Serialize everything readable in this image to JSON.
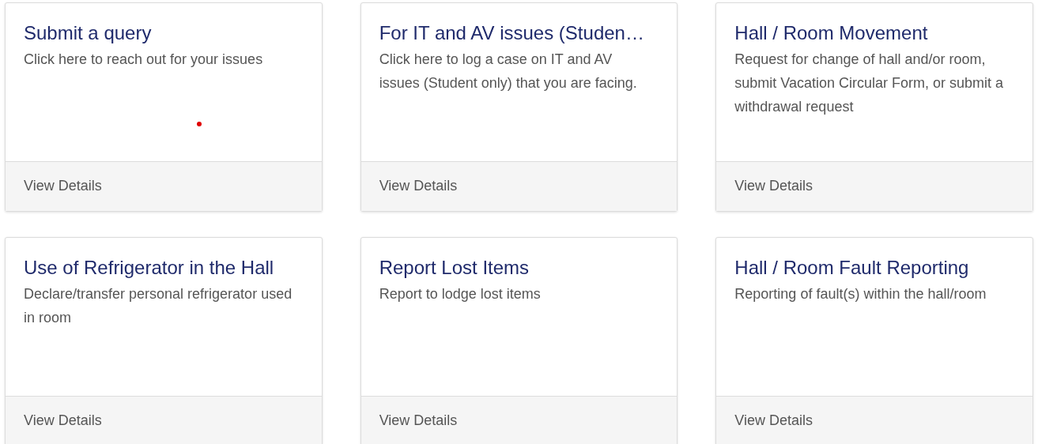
{
  "cards": [
    {
      "title": "Submit a query",
      "description": "Click here to reach out for your issues",
      "link": "View Details"
    },
    {
      "title": "For IT and AV issues (Studen…",
      "description": "Click here to log a case on IT and AV issues (Student only) that you are facing.",
      "link": "View Details"
    },
    {
      "title": "Hall / Room Movement",
      "description": "Request for change of hall and/or room, submit Vacation Circular Form, or submit a withdrawal request",
      "link": "View Details"
    },
    {
      "title": "Use of Refrigerator in the Hall",
      "description": "Declare/transfer personal refrigerator used in room",
      "link": "View Details"
    },
    {
      "title": "Report Lost Items",
      "description": "Report to lodge lost items",
      "link": "View Details"
    },
    {
      "title": "Hall / Room Fault Reporting",
      "description": "Reporting of fault(s) within the hall/room",
      "link": "View Details"
    }
  ]
}
